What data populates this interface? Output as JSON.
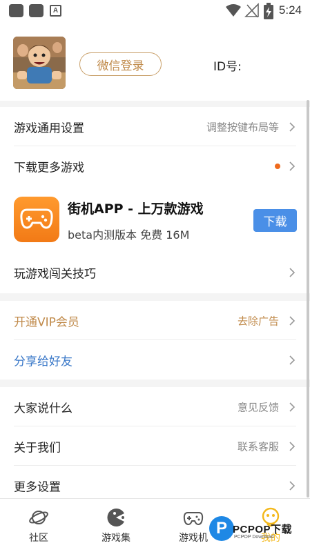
{
  "status_bar": {
    "time": "5:24",
    "a_badge": "A",
    "icons": [
      "app-square-icon",
      "app-square-icon",
      "a-icon",
      "wifi-icon",
      "no-signal-icon",
      "battery-charging-icon"
    ]
  },
  "profile": {
    "login_label": "微信登录",
    "id_label": "ID号:"
  },
  "menu": {
    "general_settings": {
      "label": "游戏通用设置",
      "hint": "调整按键布局等"
    },
    "download_more": {
      "label": "下载更多游戏"
    },
    "app_promo": {
      "title": "街机APP - 上万款游戏",
      "subtitle": "beta内测版本 免费 16M",
      "button": "下载"
    },
    "tips": {
      "label": "玩游戏闯关技巧"
    },
    "vip": {
      "label": "开通VIP会员",
      "hint": "去除广告"
    },
    "share": {
      "label": "分享给好友"
    },
    "feedback": {
      "label": "大家说什么",
      "hint": "意见反馈"
    },
    "about": {
      "label": "关于我们",
      "hint": "联系客服"
    },
    "more_settings": {
      "label": "更多设置"
    }
  },
  "tabbar": {
    "tabs": [
      {
        "label": "社区",
        "icon": "planet-icon"
      },
      {
        "label": "游戏集",
        "icon": "pacman-icon"
      },
      {
        "label": "游戏机",
        "icon": "gamepad-icon"
      },
      {
        "label": "我的",
        "icon": "face-icon"
      }
    ],
    "active_color": "#f3b81b"
  },
  "watermark": {
    "letter": "P",
    "brand": "PCPOP下载",
    "small": "PCPOP Download"
  },
  "colors": {
    "gold": "#c08a4a",
    "blue": "#3a78c8",
    "download_button": "#4a8fe7",
    "notification_dot": "#ef6a1d",
    "app_icon": "#f58a1f"
  }
}
